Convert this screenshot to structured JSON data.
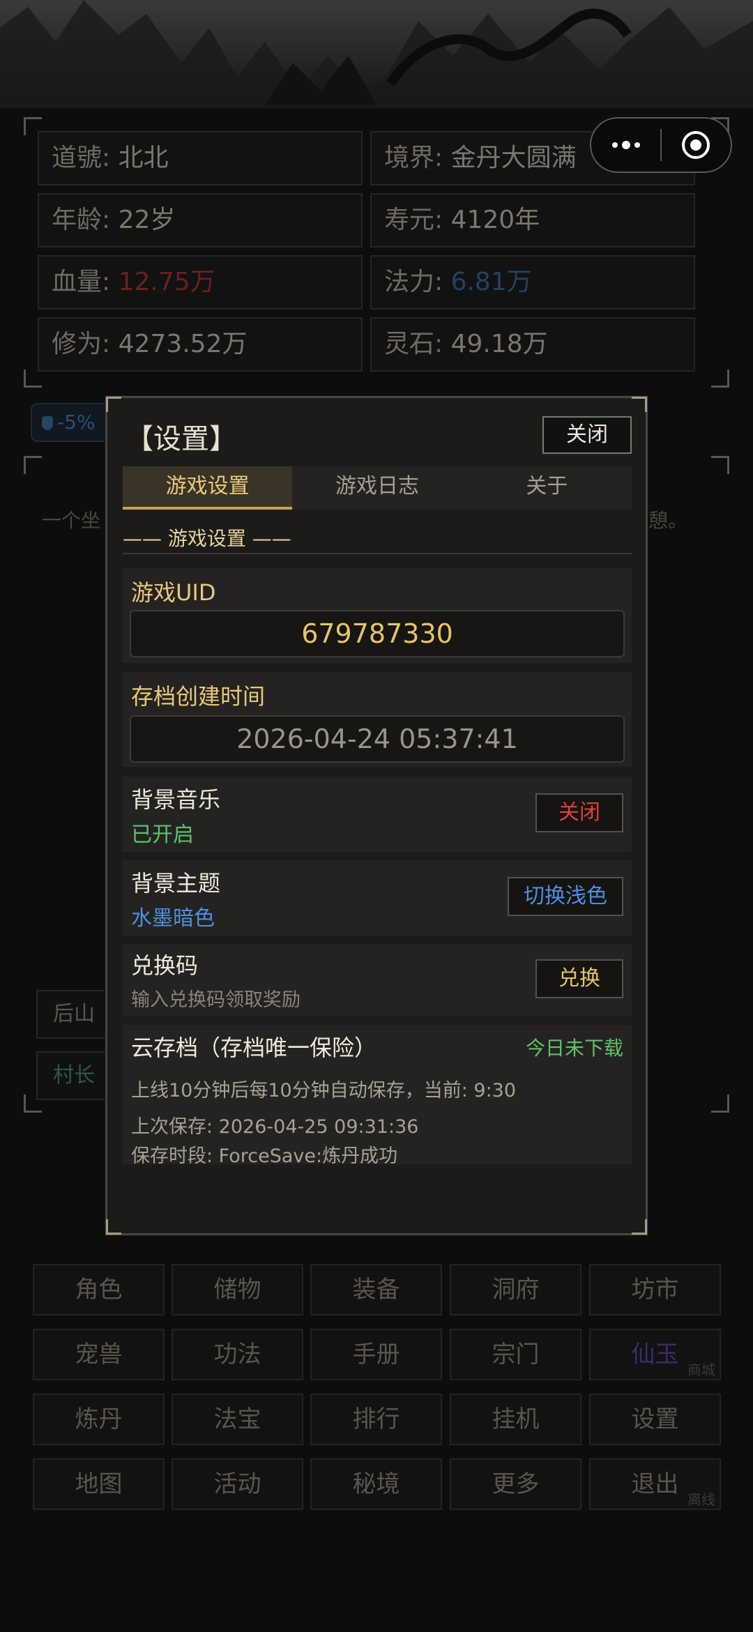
{
  "capsule": {
    "more_icon": "more-dots-icon",
    "close_icon": "miniapp-target-icon"
  },
  "stats": [
    {
      "label": "道號: ",
      "value": "北北",
      "color": ""
    },
    {
      "label": "境界: ",
      "value": "金丹大圆满",
      "color": ""
    },
    {
      "label": "年龄: ",
      "value": "22岁",
      "color": ""
    },
    {
      "label": "寿元: ",
      "value": "4120年",
      "color": ""
    },
    {
      "label": "血量: ",
      "value": "12.75万",
      "color": "red"
    },
    {
      "label": "法力: ",
      "value": "6.81万",
      "color": "blue"
    },
    {
      "label": "修为: ",
      "value": "4273.52万",
      "color": ""
    },
    {
      "label": "灵石: ",
      "value": "49.18万",
      "color": ""
    }
  ],
  "buff": {
    "icon": "shield-icon",
    "text": "-5%"
  },
  "story": {
    "left": "一个坐",
    "right": "憩。"
  },
  "places": {
    "a": "后山",
    "b": "村长"
  },
  "modal": {
    "title": "【设置】",
    "close_label": "关闭",
    "tabs": [
      {
        "label": "游戏设置",
        "active": true
      },
      {
        "label": "游戏日志",
        "active": false
      },
      {
        "label": "关于",
        "active": false
      }
    ],
    "section_heading": "—— 游戏设置 ——",
    "uid": {
      "label": "游戏UID",
      "value": "679787330"
    },
    "created": {
      "label": "存档创建时间",
      "value": "2026-04-24 05:37:41"
    },
    "music": {
      "label": "背景音乐",
      "status": "已开启",
      "button": "关闭"
    },
    "theme": {
      "label": "背景主题",
      "status": "水墨暗色",
      "button": "切换浅色"
    },
    "redeem": {
      "label": "兑换码",
      "hint": "输入兑换码领取奖励",
      "button": "兑换"
    },
    "cloud": {
      "title": "云存档（存档唯一保险）",
      "status": "今日未下载",
      "line1": "上线10分钟后每10分钟自动保存，当前: 9:30",
      "line2": "上次保存: 2026-04-25 09:31:36",
      "line3": "保存时段: ForceSave:炼丹成功"
    }
  },
  "menu": [
    {
      "label": "角色"
    },
    {
      "label": "储物"
    },
    {
      "label": "装备"
    },
    {
      "label": "洞府"
    },
    {
      "label": "坊市"
    },
    {
      "label": "宠兽"
    },
    {
      "label": "功法"
    },
    {
      "label": "手册"
    },
    {
      "label": "宗门"
    },
    {
      "label": "仙玉",
      "sub": "商城",
      "color": "purple"
    },
    {
      "label": "炼丹"
    },
    {
      "label": "法宝"
    },
    {
      "label": "排行"
    },
    {
      "label": "挂机"
    },
    {
      "label": "设置"
    },
    {
      "label": "地图"
    },
    {
      "label": "活动"
    },
    {
      "label": "秘境"
    },
    {
      "label": "更多"
    },
    {
      "label": "退出",
      "sub": "离线"
    }
  ]
}
